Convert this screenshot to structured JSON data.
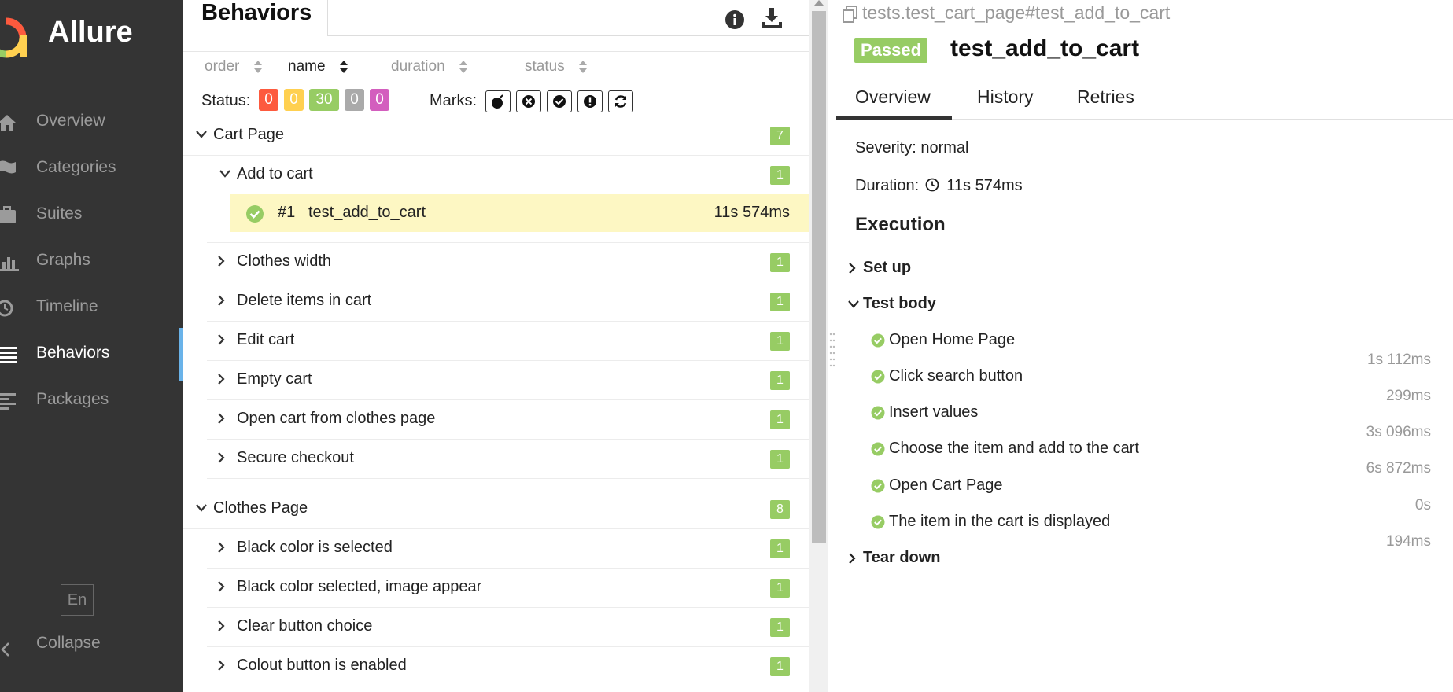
{
  "sidebar": {
    "app_name": "Allure",
    "nav": [
      {
        "label": "Overview",
        "icon": "home-icon"
      },
      {
        "label": "Categories",
        "icon": "flag-icon"
      },
      {
        "label": "Suites",
        "icon": "briefcase-icon"
      },
      {
        "label": "Graphs",
        "icon": "bar-chart-icon"
      },
      {
        "label": "Timeline",
        "icon": "clock-icon"
      },
      {
        "label": "Behaviors",
        "icon": "list-icon",
        "active": true
      },
      {
        "label": "Packages",
        "icon": "align-left-icon"
      }
    ],
    "language": "En",
    "collapse_label": "Collapse"
  },
  "behaviors": {
    "title": "Behaviors",
    "search_value": "",
    "sort": {
      "order": "order",
      "name": "name",
      "duration": "duration",
      "status": "status",
      "active": "name"
    },
    "status_label": "Status:",
    "status_counts": {
      "failed": "0",
      "broken": "0",
      "passed": "30",
      "skipped": "0",
      "unknown": "0"
    },
    "marks_label": "Marks:",
    "marks": [
      "flaky-icon",
      "new-failed-icon",
      "new-passed-icon",
      "new-broken-icon",
      "retries-icon"
    ],
    "groups": [
      {
        "name": "Cart Page",
        "count": "7",
        "expanded": true,
        "features": [
          {
            "name": "Add to cart",
            "count": "1",
            "expanded": true,
            "tests": [
              {
                "number": "#1",
                "name": "test_add_to_cart",
                "duration": "11s 574ms",
                "status": "passed"
              }
            ]
          },
          {
            "name": "Clothes width",
            "count": "1"
          },
          {
            "name": "Delete items in cart",
            "count": "1"
          },
          {
            "name": "Edit cart",
            "count": "1"
          },
          {
            "name": "Empty cart",
            "count": "1"
          },
          {
            "name": "Open cart from clothes page",
            "count": "1"
          },
          {
            "name": "Secure checkout",
            "count": "1"
          }
        ]
      },
      {
        "name": "Clothes Page",
        "count": "8",
        "expanded": true,
        "features": [
          {
            "name": "Black color is selected",
            "count": "1"
          },
          {
            "name": "Black color selected, image appear",
            "count": "1"
          },
          {
            "name": "Clear button choice",
            "count": "1"
          },
          {
            "name": "Colout button is enabled",
            "count": "1"
          }
        ]
      }
    ]
  },
  "test_detail": {
    "path": "tests.test_cart_page#test_add_to_cart",
    "status": "Passed",
    "name": "test_add_to_cart",
    "tabs": [
      "Overview",
      "History",
      "Retries"
    ],
    "active_tab": "Overview",
    "severity": "Severity: normal",
    "duration_label": "Duration:",
    "duration_value": "11s 574ms",
    "execution_title": "Execution",
    "setup_label": "Set up",
    "test_body_label": "Test body",
    "steps": [
      {
        "name": "Open Home Page",
        "time": "1s 112ms"
      },
      {
        "name": "Click search button",
        "time": "299ms"
      },
      {
        "name": "Insert values",
        "time": "3s 096ms"
      },
      {
        "name": "Choose the item and add to the cart",
        "time": "6s 872ms"
      },
      {
        "name": "Open Cart Page",
        "time": "0s"
      },
      {
        "name": "The item in the cart is displayed",
        "time": "194ms"
      }
    ],
    "teardown_label": "Tear down"
  },
  "colors": {
    "sidebar_bg": "#343434",
    "active_accent": "#6ab3e9",
    "passed": "#97cc64",
    "failed": "#fd5a3e",
    "broken": "#ffd050",
    "skipped": "#aaaaaa",
    "unknown": "#d35ebe",
    "selected_row": "#fdf7c3"
  }
}
